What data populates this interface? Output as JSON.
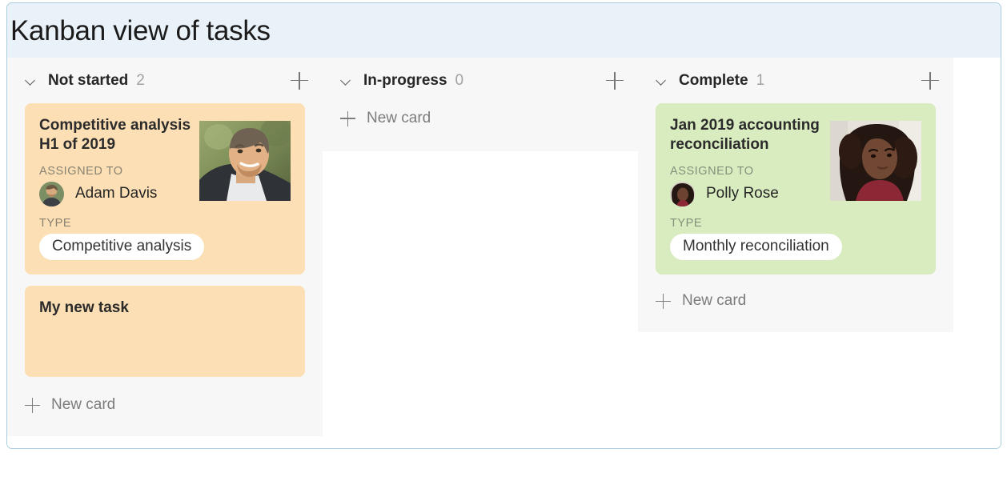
{
  "board": {
    "title": "Kanban view of tasks",
    "accent_border_color": "#a8cedd",
    "header_bg_color": "#e9f1f9",
    "column_bg_color": "#f7f7f7"
  },
  "columns": [
    {
      "name": "Not started",
      "count": "2",
      "add_icon": "plus-icon",
      "collapse_icon": "chevron-down-icon",
      "theme": "orange",
      "card_color": "#fcdfb4",
      "new_card_label": "New card",
      "cards": [
        {
          "title": "Competitive analysis H1 of 2019",
          "assigned_label": "ASSIGNED TO",
          "assignee": "Adam Davis",
          "type_label": "TYPE",
          "type_value": "Competitive analysis",
          "has_photo": true,
          "photo_alt": "adam-davis-photo",
          "avatar_alt": "adam-davis-avatar"
        },
        {
          "title": "My new task",
          "assigned_label": "",
          "assignee": "",
          "type_label": "",
          "type_value": "",
          "has_photo": false
        }
      ]
    },
    {
      "name": "In-progress",
      "count": "0",
      "add_icon": "plus-icon",
      "collapse_icon": "chevron-down-icon",
      "theme": "none",
      "card_color": "",
      "new_card_label": "New card",
      "cards": []
    },
    {
      "name": "Complete",
      "count": "1",
      "add_icon": "plus-icon",
      "collapse_icon": "chevron-down-icon",
      "theme": "green",
      "card_color": "#d9ecc0",
      "new_card_label": "New card",
      "cards": [
        {
          "title": "Jan 2019 accounting reconciliation",
          "assigned_label": "ASSIGNED TO",
          "assignee": "Polly Rose",
          "type_label": "TYPE",
          "type_value": "Monthly reconciliation",
          "has_photo": true,
          "photo_alt": "polly-rose-photo",
          "avatar_alt": "polly-rose-avatar"
        }
      ]
    }
  ]
}
